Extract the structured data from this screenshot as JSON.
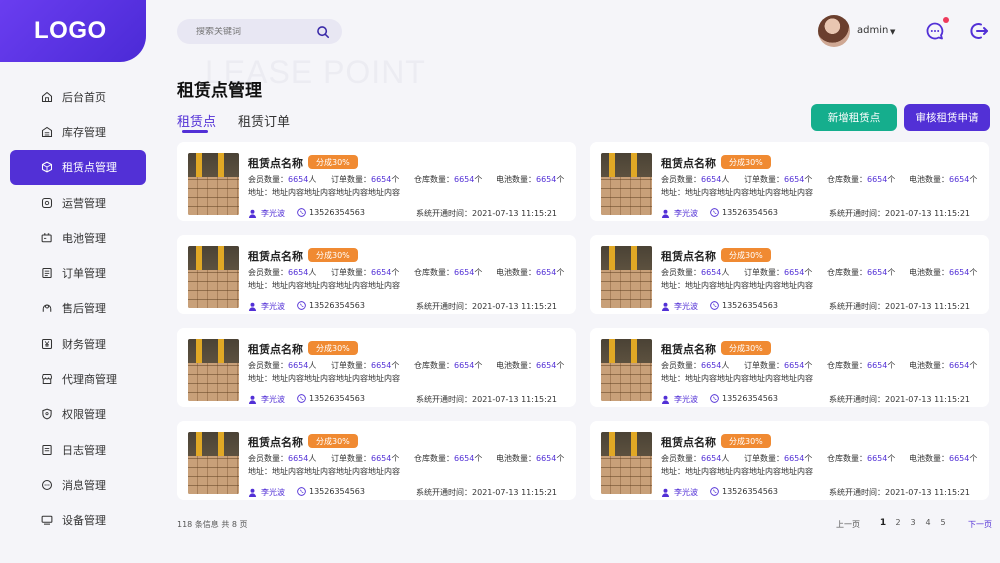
{
  "logo": "LOGO",
  "sidebar": {
    "items": [
      {
        "label": "后台首页",
        "icon": "home-icon"
      },
      {
        "label": "库存管理",
        "icon": "inventory-icon"
      },
      {
        "label": "租赁点管理",
        "icon": "cube-icon",
        "active": true
      },
      {
        "label": "运营管理",
        "icon": "operations-icon"
      },
      {
        "label": "电池管理",
        "icon": "battery-icon"
      },
      {
        "label": "订单管理",
        "icon": "order-icon"
      },
      {
        "label": "售后管理",
        "icon": "service-icon"
      },
      {
        "label": "财务管理",
        "icon": "finance-icon"
      },
      {
        "label": "代理商管理",
        "icon": "store-icon"
      },
      {
        "label": "权限管理",
        "icon": "shield-icon"
      },
      {
        "label": "日志管理",
        "icon": "log-icon"
      },
      {
        "label": "消息管理",
        "icon": "message-icon"
      },
      {
        "label": "设备管理",
        "icon": "device-icon"
      }
    ]
  },
  "header": {
    "search_placeholder": "搜索关键词",
    "user_name": "admin",
    "caret": "▼"
  },
  "page": {
    "watermark": "LEASE POINT",
    "title": "租赁点管理",
    "tabs": [
      "租赁点",
      "租赁订单"
    ],
    "add_button": "新增租赁点",
    "audit_button": "审核租赁申请"
  },
  "card": {
    "name": "租赁点名称",
    "tag": "分成30%",
    "stats": [
      {
        "label": "会员数量：",
        "value": "6654",
        "unit": "人"
      },
      {
        "label": "订单数量：",
        "value": "6654",
        "unit": "个"
      },
      {
        "label": "仓库数量：",
        "value": "6654",
        "unit": "个"
      },
      {
        "label": "电池数量：",
        "value": "6654",
        "unit": "个"
      }
    ],
    "address": "地址：地址内容地址内容地址内容地址内容",
    "person": "李光波",
    "phone": "13526354563",
    "time": "系统开通时间：2021-07-13  11:15:21"
  },
  "colors": {
    "primary": "#5230d6",
    "green": "#15ae8d",
    "orange": "#f08a32"
  },
  "footer": {
    "total": "118 条信息 共 8 页",
    "prev": "上一页",
    "pages": [
      "1",
      "2",
      "3",
      "4",
      "5"
    ],
    "current_page": "1",
    "next": "下一页"
  }
}
